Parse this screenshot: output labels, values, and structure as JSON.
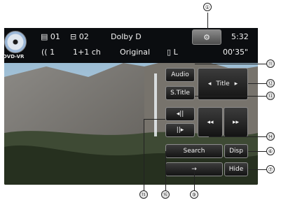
{
  "status": {
    "disc_type": "DVD-VR",
    "title_no": "01",
    "chapter_no": "02",
    "audio_format": "Dolby D",
    "time": "5:32",
    "audio_stream": "1",
    "channels": "1+1 ch",
    "original": "Original",
    "lr": "L",
    "elapsed": "00'35\""
  },
  "buttons": {
    "audio": "Audio",
    "subtitle": "S.Title",
    "title": "Title",
    "search": "Search",
    "disp": "Disp",
    "hide": "Hide"
  },
  "callouts": {
    "c1": "①",
    "c11": "⑪",
    "c12": "⑫",
    "c13": "⑬",
    "c14": "⑭",
    "c6": "⑥",
    "c7": "⑦",
    "c15": "⑮",
    "c16": "⑯",
    "c9": "⑨"
  }
}
